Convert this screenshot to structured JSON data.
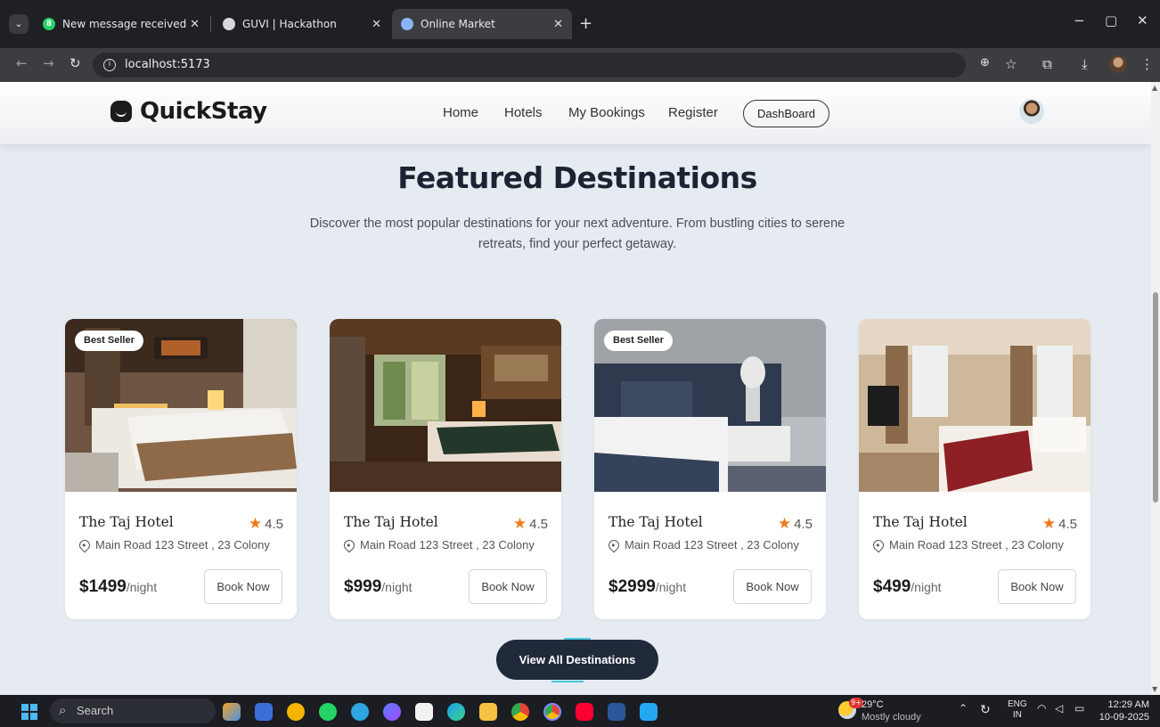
{
  "browser": {
    "tabs": [
      {
        "title": "New message received",
        "badge": "8"
      },
      {
        "title": "GUVI | Hackathon"
      },
      {
        "title": "Online Market"
      }
    ],
    "url": "localhost:5173",
    "new_tab_label": "+",
    "minimize_label": "−",
    "restore_label": "▢",
    "close_label": "✕",
    "tab_close_label": "✕"
  },
  "navbar": {
    "brand": "QuickStay",
    "links": [
      "Home",
      "Hotels",
      "My Bookings",
      "Register"
    ],
    "dashboard_label": "DashBoard"
  },
  "section": {
    "title": "Featured Destinations",
    "subtitle": "Discover the most popular destinations for your next adventure. From bustling cities to serene retreats, find your perfect getaway."
  },
  "cards": [
    {
      "badge": "Best Seller",
      "name": "The Taj Hotel",
      "rating": "4.5",
      "address": "Main Road 123 Street , 23 Colony",
      "price": "$1499",
      "per": "/night",
      "button": "Book Now"
    },
    {
      "badge": "",
      "name": "The Taj Hotel",
      "rating": "4.5",
      "address": "Main Road 123 Street , 23 Colony",
      "price": "$999",
      "per": "/night",
      "button": "Book Now"
    },
    {
      "badge": "Best Seller",
      "name": "The Taj Hotel",
      "rating": "4.5",
      "address": "Main Road 123 Street , 23 Colony",
      "price": "$2999",
      "per": "/night",
      "button": "Book Now"
    },
    {
      "badge": "",
      "name": "The Taj Hotel",
      "rating": "4.5",
      "address": "Main Road 123 Street , 23 Colony",
      "price": "$499",
      "per": "/night",
      "button": "Book Now"
    }
  ],
  "view_all_label": "View All Destinations",
  "taskbar": {
    "search_label": "Search",
    "weather_temp": "29°C",
    "weather_cond": "Mostly cloudy",
    "weather_badge": "9+",
    "lang_top": "ENG",
    "lang_bottom": "IN",
    "time": "12:29 AM",
    "date": "10-09-2025"
  },
  "colors": {
    "page_bg": "#e5ebf1",
    "accent_dark": "#212a3b",
    "star": "#f07a1c"
  }
}
